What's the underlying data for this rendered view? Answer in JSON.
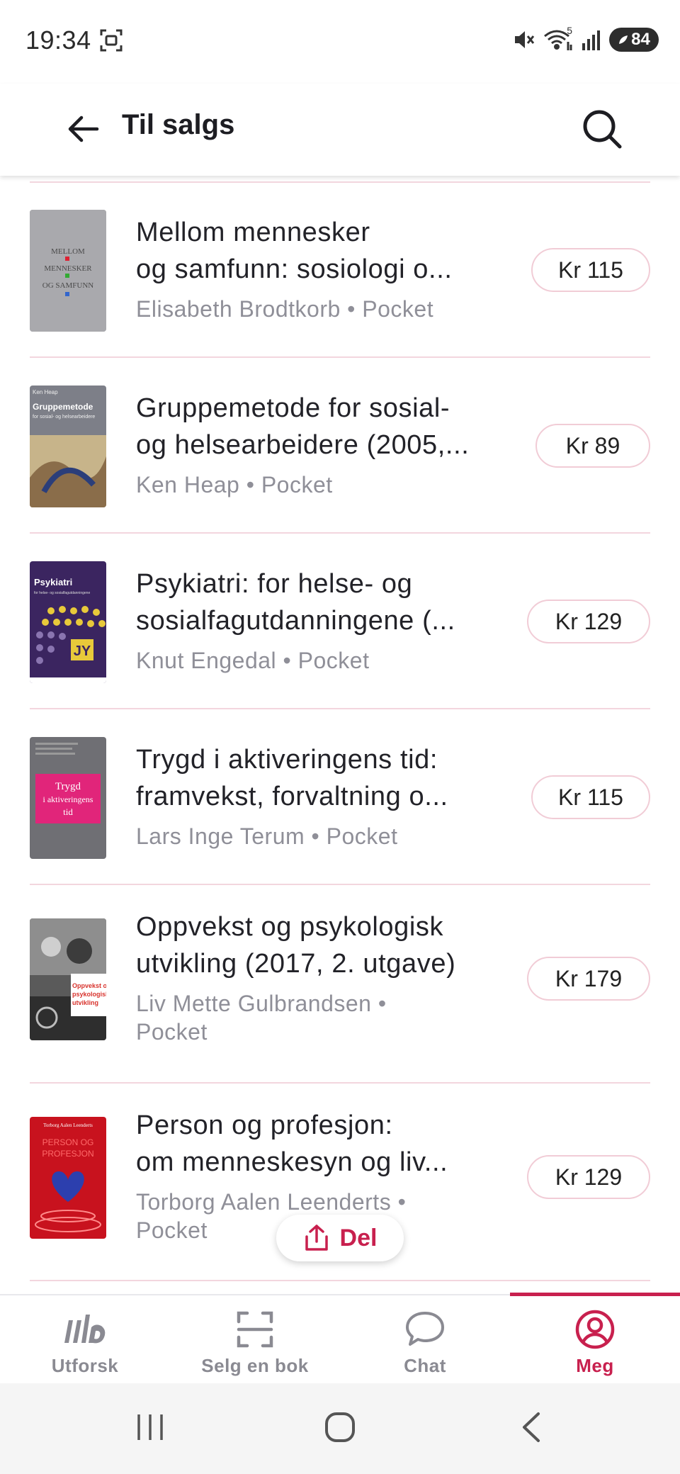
{
  "status_bar": {
    "time": "19:34",
    "battery": "84",
    "signal_superscript": "5",
    "icons": [
      "screenshot-icon",
      "mute-icon",
      "wifi-icon",
      "signal-icon",
      "battery-saver-icon"
    ]
  },
  "header": {
    "title": "Til salgs",
    "back_icon": "arrow-left-icon",
    "search_icon": "search-icon"
  },
  "listings": [
    {
      "title_line1": "Mellom mennesker",
      "title_line2": "og samfunn: sosiologi o...",
      "meta": "Elisabeth Brodtkorb • Pocket",
      "meta_line2": "",
      "price": "Kr 115",
      "cover": {
        "bg": "#a9a9ad",
        "lines": [
          "MELLOM",
          "MENNESKER",
          "OG SAMFUNN"
        ]
      }
    },
    {
      "title_line1": "Gruppemetode for sosial-",
      "title_line2": "og helsearbeidere (2005,...",
      "meta": "Ken Heap • Pocket",
      "meta_line2": "",
      "price": "Kr 89",
      "cover": {
        "bg": "#7d7f88",
        "lines": [
          "Ken Heap",
          "Gruppemetode",
          "for sosial- og helsearbeidere"
        ]
      }
    },
    {
      "title_line1": "Psykiatri: for helse- og",
      "title_line2": "sosialfagutdanningene (...",
      "meta": "Knut Engedal • Pocket",
      "meta_line2": "",
      "price": "Kr 129",
      "cover": {
        "bg": "#3b2560",
        "lines": [
          "Psykiatri",
          "for helse- og sosialfagutdanningene"
        ]
      }
    },
    {
      "title_line1": "Trygd i aktiveringens tid:",
      "title_line2": "framvekst, forvaltning o...",
      "meta": "Lars Inge Terum • Pocket",
      "meta_line2": "",
      "price": "Kr 115",
      "cover": {
        "bg": "#6f6f74",
        "lines": [
          "Trygd",
          "i aktiveringens",
          "tid"
        ]
      }
    },
    {
      "title_line1": "Oppvekst og psykologisk",
      "title_line2": "utvikling (2017, 2. utgave)",
      "meta": "Liv Mette Gulbrandsen •",
      "meta_line2": "Pocket",
      "price": "Kr 179",
      "cover": {
        "bg": "#5a5a5a",
        "lines": [
          "Oppvekst og",
          "psykologisk",
          "utvikling"
        ]
      }
    },
    {
      "title_line1": "Person og profesjon:",
      "title_line2": "om menneskesyn og liv...",
      "meta": "Torborg Aalen Leenderts •",
      "meta_line2": "Pocket",
      "price": "Kr 129",
      "cover": {
        "bg": "#c8121e",
        "lines": [
          "Torborg Aalen Leenderts",
          "PERSON OG",
          "PROFESJON"
        ]
      }
    }
  ],
  "share": {
    "label": "Del",
    "icon": "share-icon"
  },
  "nav": {
    "items": [
      {
        "label": "Utforsk",
        "icon": "explore-logo-icon"
      },
      {
        "label": "Selg en bok",
        "icon": "scan-icon"
      },
      {
        "label": "Chat",
        "icon": "chat-bubble-icon"
      },
      {
        "label": "Meg",
        "icon": "profile-icon"
      }
    ],
    "active": "Meg",
    "accent": "#c8204e"
  },
  "system_nav": {
    "icons": [
      "recent-apps-icon",
      "home-icon",
      "back-icon"
    ]
  }
}
